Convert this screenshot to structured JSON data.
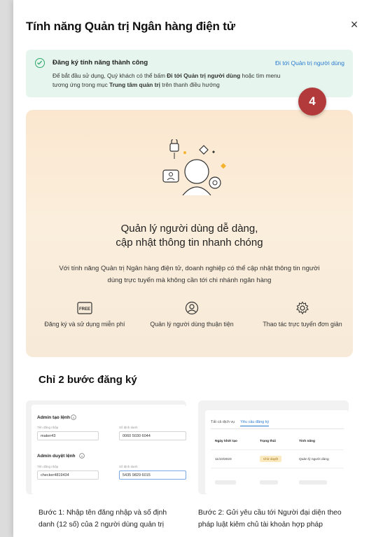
{
  "modal": {
    "title": "Tính năng Quản trị Ngân hàng điện tử",
    "close_symbol": "×"
  },
  "toast": {
    "icon": "check-circle-icon",
    "title": "Đăng ký tính năng thành công",
    "body_prefix": "Để bắt đầu sử dụng, Quý khách có thể bấm ",
    "body_bold1": "Đi tới Quản trị người dùng",
    "body_middle": " hoặc tìm menu tương ứng trong mục ",
    "body_bold2": "Trung tâm quản trị",
    "body_suffix": " trên thanh điều hướng",
    "link": "Đi tới Quản trị người dùng",
    "accent": "#2fa86a",
    "link_color": "#2a7ad1"
  },
  "step_badge": "4",
  "hero": {
    "heading_line1": "Quản lý người dùng dễ dàng,",
    "heading_line2": "cập nhật thông tin nhanh chóng",
    "desc": "Với tính năng Quản trị Ngân hàng điện tử, doanh nghiệp có thể cập nhật thông tin người dùng trực tuyến mà không cần tới chi nhánh ngân hàng",
    "features": [
      {
        "icon": "free-badge-icon",
        "icon_text": "FREE",
        "label": "Đăng ký và sử dụng miễn phí"
      },
      {
        "icon": "user-circle-icon",
        "label": "Quản lý người dùng thuận tiện"
      },
      {
        "icon": "gear-icon",
        "label": "Thao tác trực tuyến đơn giản"
      }
    ]
  },
  "steps_section": {
    "title": "Chỉ 2 bước đăng ký",
    "card1": {
      "maker_title": "Admin tạo lệnh",
      "maker_user_label": "Tên đăng nhập",
      "maker_user_value": "maker43",
      "maker_id_label": "Số định danh",
      "maker_id_value": "0060 5030 6044",
      "checker_title": "Admin duyệt lệnh",
      "checker_user_label": "Tên đăng nhập",
      "checker_user_value": "checker4819434",
      "checker_id_label": "Số định danh",
      "checker_id_value": "5435 9829 6015"
    },
    "card2": {
      "tab_all": "Tất cả dịch vụ",
      "tab_requests": "Yêu cầu đăng ký",
      "col_date": "Ngày khởi tạo",
      "col_status": "Trạng thái",
      "col_feature": "Tính năng",
      "row_date": "11/10/2023",
      "row_status": "Chờ duyệt",
      "row_feature": "Quản lý người dùng"
    },
    "step1_line1": "Bước 1: Nhập tên đăng nhập và số định",
    "step1_line2": "danh (12 số) của 2 người dùng quản trị",
    "step2_line1": "Bước 2: Gửi yêu cầu tới Người đại diện theo",
    "step2_line2": "pháp luật kiêm chủ tài khoản hợp pháp"
  }
}
